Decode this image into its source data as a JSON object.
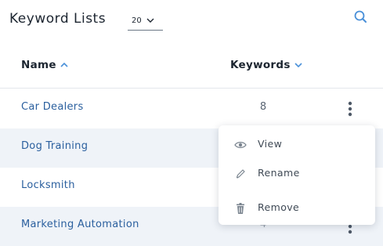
{
  "header": {
    "title": "Keyword Lists",
    "per_page": {
      "value": "20"
    }
  },
  "table": {
    "columns": [
      {
        "label": "Name",
        "sort": "asc"
      },
      {
        "label": "Keywords",
        "sort": "desc"
      }
    ],
    "rows": [
      {
        "name": "Car Dealers",
        "keywords": "8"
      },
      {
        "name": "Dog Training",
        "keywords": ""
      },
      {
        "name": "Locksmith",
        "keywords": ""
      },
      {
        "name": "Marketing Automation",
        "keywords": "4"
      }
    ]
  },
  "context_menu": {
    "items": [
      {
        "label": "View",
        "icon": "eye-icon"
      },
      {
        "label": "Rename",
        "icon": "pencil-icon"
      },
      {
        "label": "Remove",
        "icon": "trash-icon"
      }
    ]
  },
  "colors": {
    "accent": "#4a90d9",
    "link": "#2a5f9e",
    "row_alt": "#eff3f8"
  }
}
